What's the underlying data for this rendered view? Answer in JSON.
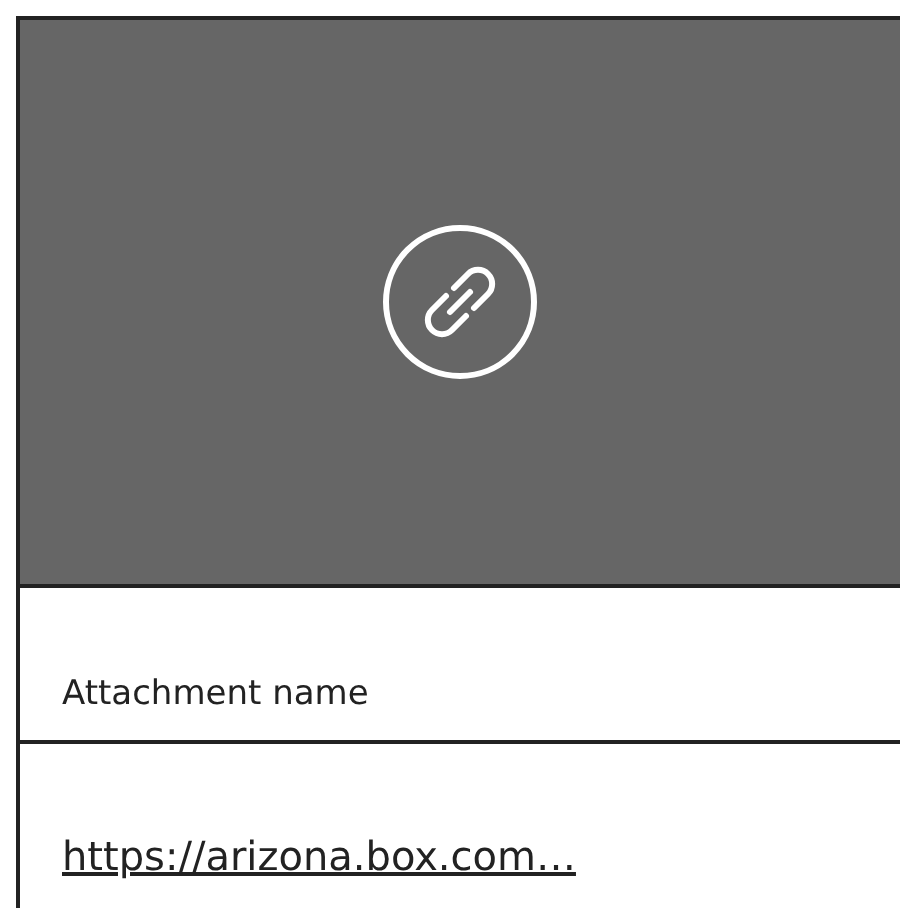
{
  "attachment": {
    "kind": "link",
    "name": "Attachment name",
    "url": "https://arizona.box.com…"
  }
}
